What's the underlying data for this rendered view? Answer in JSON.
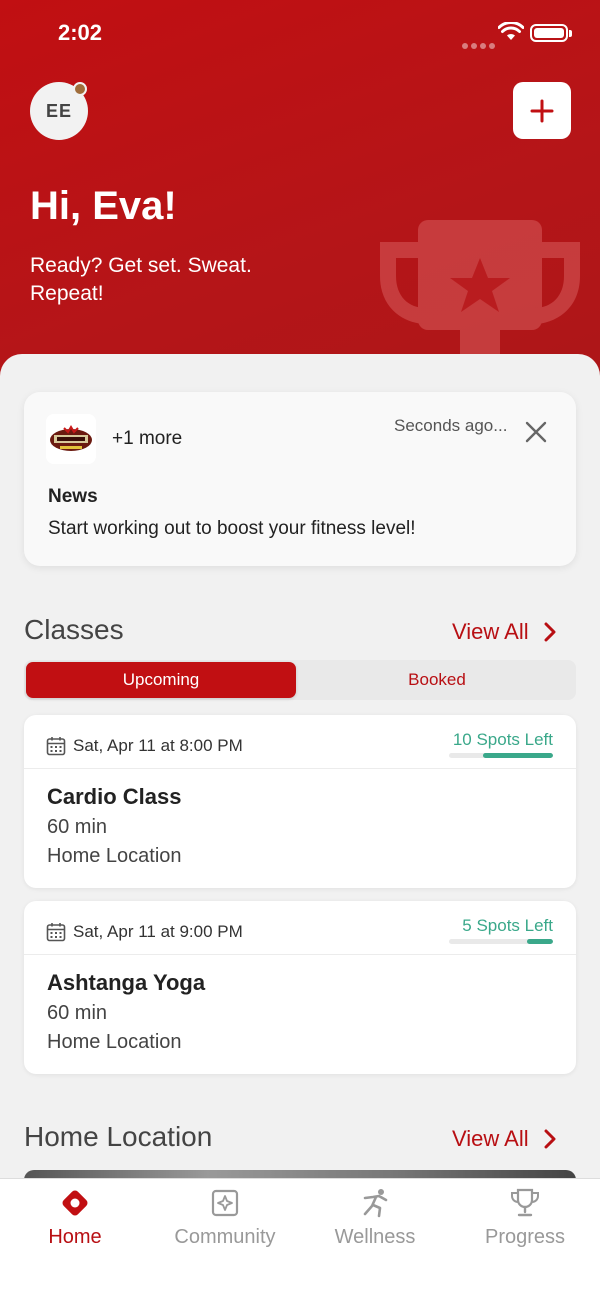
{
  "status_bar": {
    "time": "2:02"
  },
  "header": {
    "avatar_initials": "EE",
    "greeting": "Hi, Eva!",
    "tagline": "Ready? Get set. Sweat. Repeat!",
    "add_icon": "plus-icon",
    "background_icon": "trophy-icon"
  },
  "news_card": {
    "more": "+1 more",
    "time": "Seconds ago...",
    "title": "News",
    "body": "Start working out to boost your fitness level!"
  },
  "classes": {
    "title": "Classes",
    "view_all": "View All",
    "tabs": [
      {
        "label": "Upcoming",
        "active": true
      },
      {
        "label": "Booked",
        "active": false
      }
    ],
    "items": [
      {
        "date": "Sat, Apr 11 at 8:00 PM",
        "spots": "10 Spots Left",
        "spots_fraction": 0.67,
        "name": "Cardio Class",
        "duration": "60 min",
        "location": "Home Location"
      },
      {
        "date": "Sat, Apr 11 at 9:00 PM",
        "spots": "5 Spots Left",
        "spots_fraction": 0.25,
        "name": "Ashtanga Yoga",
        "duration": "60 min",
        "location": "Home Location"
      }
    ]
  },
  "home_location": {
    "title": "Home Location",
    "view_all": "View All"
  },
  "tabbar": {
    "items": [
      {
        "label": "Home",
        "icon": "home-icon",
        "active": true
      },
      {
        "label": "Community",
        "icon": "community-icon",
        "active": false
      },
      {
        "label": "Wellness",
        "icon": "wellness-icon",
        "active": false
      },
      {
        "label": "Progress",
        "icon": "progress-icon",
        "active": false
      }
    ]
  },
  "colors": {
    "brand": "#c10f12",
    "accent_text": "#b80f13",
    "spots": "#3aa88a"
  }
}
